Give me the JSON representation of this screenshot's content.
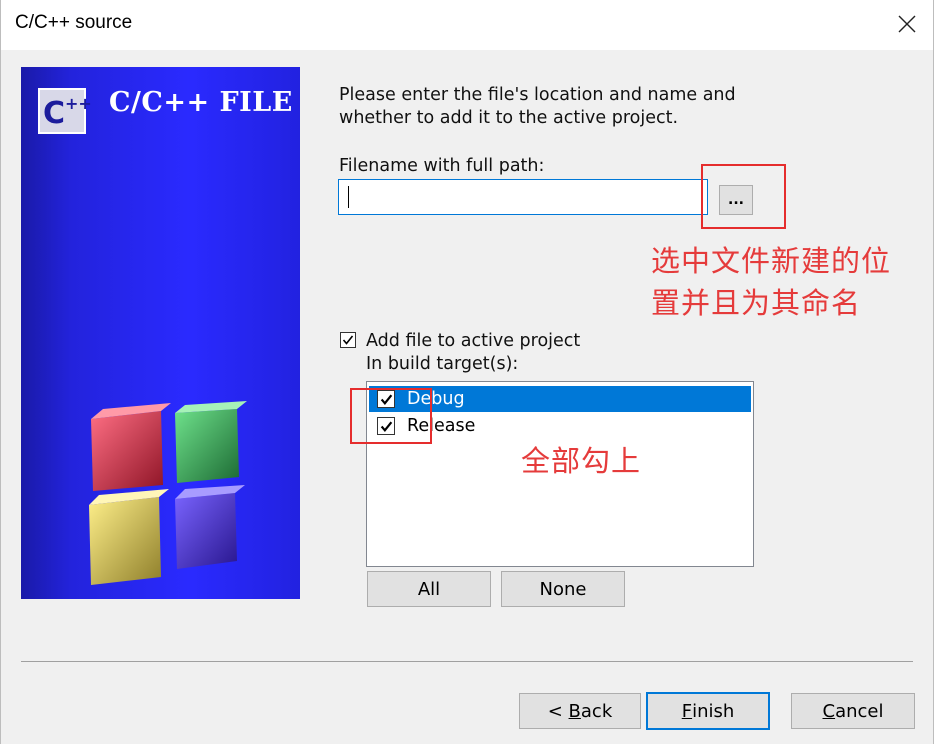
{
  "window": {
    "title": "C/C++ source",
    "close_icon": "close-icon"
  },
  "banner": {
    "logo_text": "C++",
    "title": "C/C++ FILE",
    "cube_colors": [
      "#b8283a",
      "#2f9a4c",
      "#d2c251",
      "#4b33c8"
    ]
  },
  "form": {
    "description": "Please enter the file's location and name and\nwhether to add it to the active project.",
    "filename_label": "Filename with full path:",
    "filename_value": "",
    "browse_label": "...",
    "add_to_project_label": "Add file to active project",
    "add_to_project_checked": true,
    "build_targets_label": "In build target(s):",
    "targets": [
      {
        "label": "Debug",
        "checked": true,
        "selected": true
      },
      {
        "label": "Release",
        "checked": true,
        "selected": false
      }
    ],
    "all_label": "All",
    "none_label": "None"
  },
  "footer": {
    "back_prefix": "< ",
    "back_mnemonic": "B",
    "back_rest": "ack",
    "finish_mnemonic": "F",
    "finish_rest": "inish",
    "cancel_mnemonic": "C",
    "cancel_rest": "ancel"
  },
  "annotations": {
    "path_note": "选中文件新建的位\n置并且为其命名",
    "check_note": "全部勾上",
    "color": "#e52d2d"
  }
}
